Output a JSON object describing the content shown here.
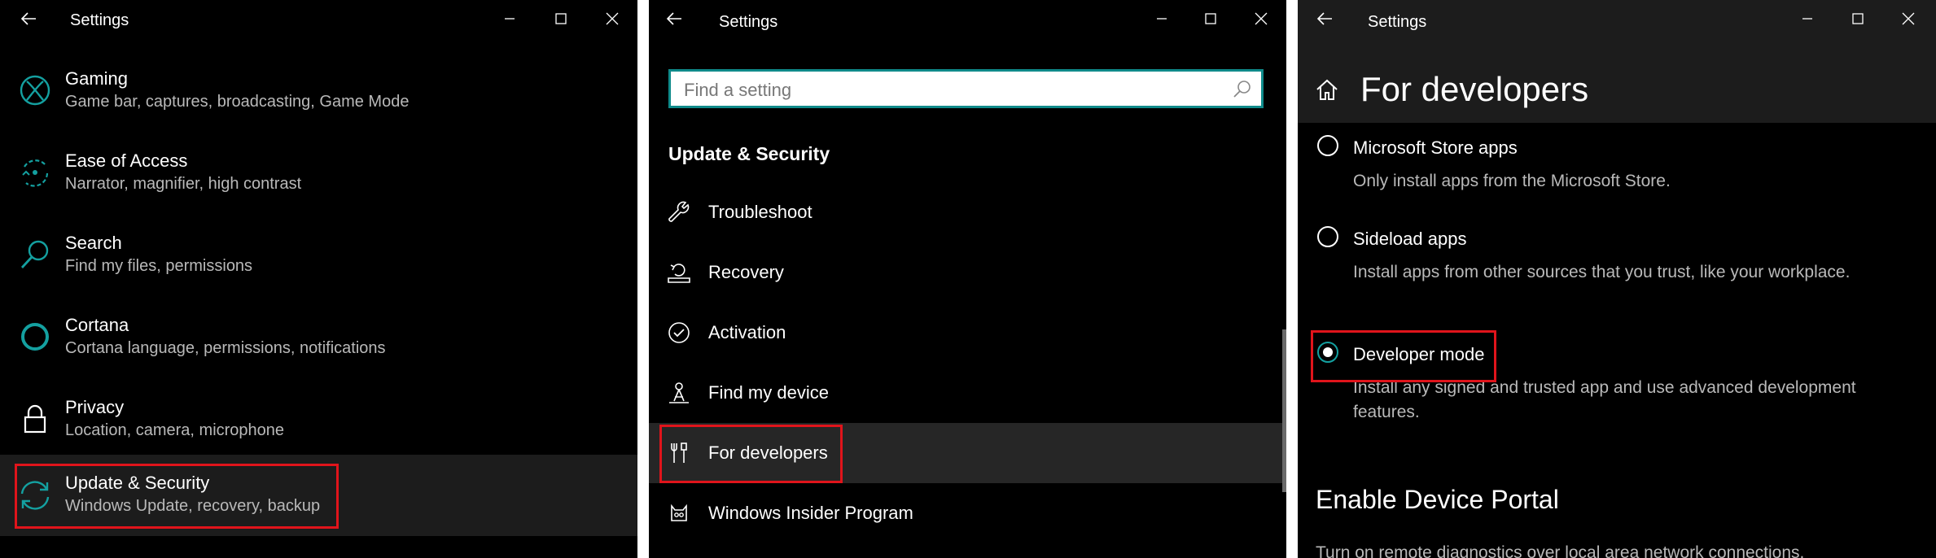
{
  "colors": {
    "accent": "#0f8a8a",
    "highlight_box": "#e0141b",
    "background": "#000000",
    "muted_text": "#b9b9b9"
  },
  "window_title": "Settings",
  "panel1": {
    "items": [
      {
        "title": "Gaming",
        "subtitle": "Game bar, captures, broadcasting, Game Mode",
        "icon": "xbox-icon"
      },
      {
        "title": "Ease of Access",
        "subtitle": "Narrator, magnifier, high contrast",
        "icon": "ease-of-access-icon"
      },
      {
        "title": "Search",
        "subtitle": "Find my files, permissions",
        "icon": "search-icon"
      },
      {
        "title": "Cortana",
        "subtitle": "Cortana language, permissions, notifications",
        "icon": "cortana-icon"
      },
      {
        "title": "Privacy",
        "subtitle": "Location, camera, microphone",
        "icon": "lock-icon"
      },
      {
        "title": "Update & Security",
        "subtitle": "Windows Update, recovery, backup",
        "icon": "sync-icon",
        "selected": true
      }
    ]
  },
  "panel2": {
    "search_placeholder": "Find a setting",
    "section_title": "Update & Security",
    "items": [
      {
        "label": "Troubleshoot",
        "icon": "wrench-icon"
      },
      {
        "label": "Recovery",
        "icon": "recovery-icon"
      },
      {
        "label": "Activation",
        "icon": "check-circle-icon"
      },
      {
        "label": "Find my device",
        "icon": "find-device-icon"
      },
      {
        "label": "For developers",
        "icon": "developer-tools-icon",
        "selected": true
      },
      {
        "label": "Windows Insider Program",
        "icon": "insider-icon"
      }
    ]
  },
  "panel3": {
    "page_title": "For developers",
    "options": [
      {
        "label": "Microsoft Store apps",
        "description": "Only install apps from the Microsoft Store.",
        "checked": false
      },
      {
        "label": "Sideload apps",
        "description": "Install apps from other sources that you trust, like your workplace.",
        "checked": false
      },
      {
        "label": "Developer mode",
        "description": "Install any signed and trusted app and use advanced development features.",
        "checked": true
      }
    ],
    "portal_title": "Enable Device Portal",
    "portal_description": "Turn on remote diagnostics over local area network connections."
  }
}
